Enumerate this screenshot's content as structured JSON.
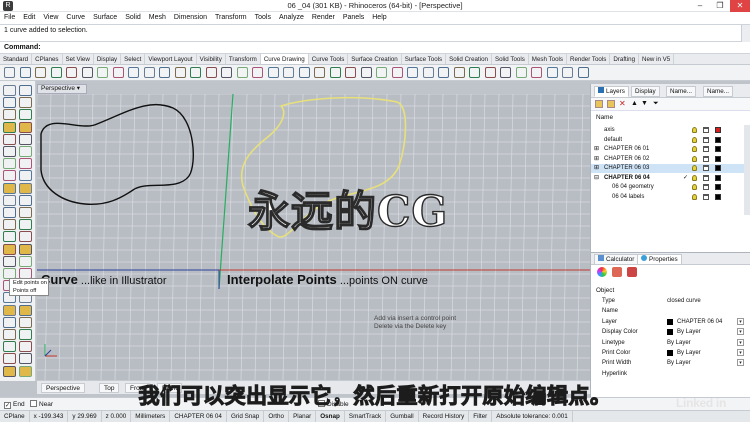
{
  "window": {
    "title": "06 _04 (301 KB) - Rhinoceros (64-bit) - [Perspective]",
    "app_icon": "R"
  },
  "menu": [
    "File",
    "Edit",
    "View",
    "Curve",
    "Surface",
    "Solid",
    "Mesh",
    "Dimension",
    "Transform",
    "Tools",
    "Analyze",
    "Render",
    "Panels",
    "Help"
  ],
  "history": {
    "message": "1 curve added to selection."
  },
  "command": {
    "label": "Command:"
  },
  "toolbar_tabs": [
    {
      "label": "Standard"
    },
    {
      "label": "CPlanes"
    },
    {
      "label": "Set View"
    },
    {
      "label": "Display"
    },
    {
      "label": "Select"
    },
    {
      "label": "Viewport Layout"
    },
    {
      "label": "Visibility"
    },
    {
      "label": "Transform"
    },
    {
      "label": "Curve Drawing",
      "active": true
    },
    {
      "label": "Curve Tools"
    },
    {
      "label": "Surface Creation"
    },
    {
      "label": "Surface Tools"
    },
    {
      "label": "Solid Creation"
    },
    {
      "label": "Solid Tools"
    },
    {
      "label": "Mesh Tools"
    },
    {
      "label": "Render Tools"
    },
    {
      "label": "Drafting"
    },
    {
      "label": "New in V5"
    }
  ],
  "viewport": {
    "tab_label": "Perspective",
    "left_text_bold": "Curve",
    "left_text_rest": " ...like in Illustrator",
    "mid_text_bold": "Interpolate Points",
    "mid_text_rest": " ...points ON curve",
    "note_line1": "Add via insert a control point",
    "note_line2": "Delete via the Delete key",
    "bottom_tabs": [
      "Perspective",
      "Top",
      "Front",
      "Right"
    ]
  },
  "tooltip": {
    "line1": "Edit points on",
    "line2": "Points off"
  },
  "watermark": {
    "text": "永远的CG"
  },
  "subtitle": {
    "text": "我们可以突出显示它，然后重新打开原始编辑点。"
  },
  "brand": {
    "text": "Linked in"
  },
  "layers_panel": {
    "tabs": [
      "Layers",
      "Display",
      "Name...",
      "Name..."
    ],
    "header": "Name",
    "rows": [
      {
        "name": "axis",
        "indent": 10,
        "color": "#d81f1f"
      },
      {
        "name": "default",
        "indent": 10,
        "color": "#000000"
      },
      {
        "name": "CHAPTER 06 01",
        "indent": 10,
        "color": "#000000",
        "expander": "⊞"
      },
      {
        "name": "CHAPTER 06 02",
        "indent": 10,
        "color": "#000000",
        "expander": "⊞"
      },
      {
        "name": "CHAPTER 06 03",
        "indent": 10,
        "color": "#000000",
        "expander": "⊞",
        "selected": true
      },
      {
        "name": "CHAPTER 06 04",
        "indent": 10,
        "color": "#000000",
        "expander": "⊟",
        "bold": true,
        "check": "✓"
      },
      {
        "name": "06 04 geometry",
        "indent": 18,
        "color": "#000000"
      },
      {
        "name": "06 04 labels",
        "indent": 18,
        "color": "#000000"
      }
    ]
  },
  "properties_panel": {
    "tabs": [
      "Calculator",
      "Properties"
    ],
    "section": "Object",
    "rows": [
      {
        "key": "Type",
        "value": "closed curve"
      },
      {
        "key": "Name",
        "value": ""
      },
      {
        "key": "Layer",
        "value": "CHAPTER 06 04",
        "swatch": true,
        "dropdown": true
      },
      {
        "key": "Display Color",
        "value": "By Layer",
        "swatch": true,
        "dropdown": true
      },
      {
        "key": "Linetype",
        "value": "By Layer",
        "dropdown": true
      },
      {
        "key": "Print Color",
        "value": "By Layer",
        "swatch": true,
        "dropdown": true
      },
      {
        "key": "Print Width",
        "value": "By Layer",
        "dropdown": true
      },
      {
        "key": "Hyperlink",
        "value": ""
      }
    ]
  },
  "osnap": {
    "items": [
      {
        "label": "End",
        "checked": true
      },
      {
        "label": "Near",
        "checked": false
      },
      {
        "label": "Disable",
        "checked": false
      }
    ]
  },
  "statusbar": [
    "CPlane",
    "x -199.343",
    "y 29.969",
    "z 0.000",
    "Millimeters",
    "CHAPTER 06 04",
    "Grid Snap",
    "Ortho",
    "Planar",
    "Osnap",
    "SmartTrack",
    "Gumball",
    "Record History",
    "Filter",
    "Absolute tolerance: 0.001"
  ],
  "colors": {
    "accent_active_tab": "#ffffff",
    "selected_row": "#cfe3f7",
    "curve_highlight": "#e8e07a",
    "axis_x": "#c0392b",
    "axis_y": "#27ae60",
    "axis_z": "#2c3e9a"
  }
}
